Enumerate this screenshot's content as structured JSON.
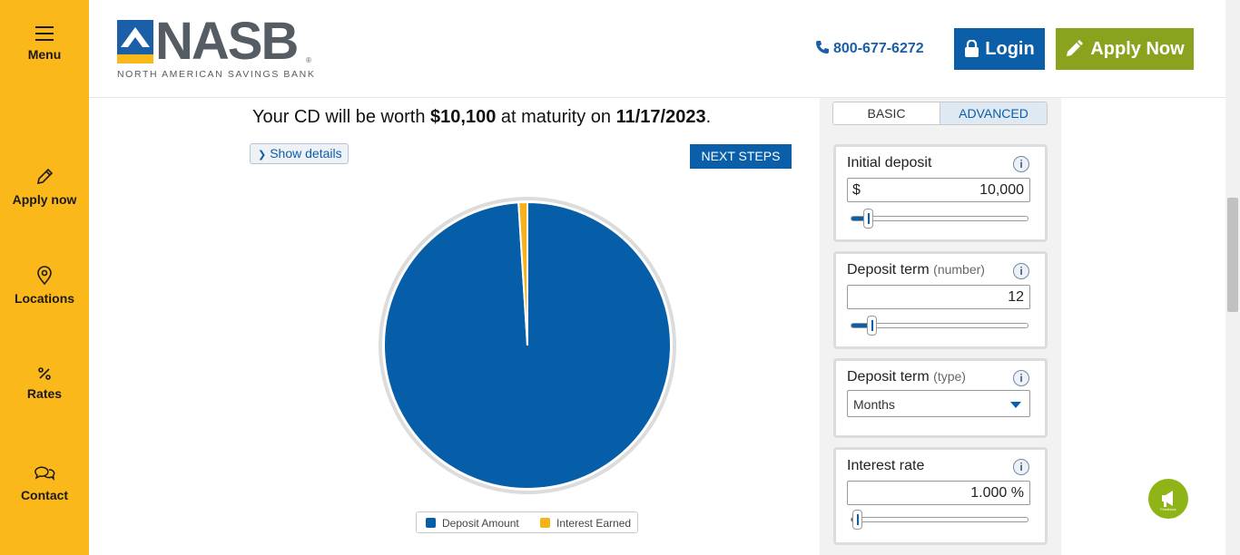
{
  "rail": {
    "menu": "Menu",
    "apply": "Apply now",
    "locations": "Locations",
    "rates": "Rates",
    "contact": "Contact"
  },
  "header": {
    "logo_word": "NASB",
    "logo_tagline": "NORTH AMERICAN SAVINGS BANK",
    "phone": "800-677-6272",
    "login": "Login",
    "apply": "Apply Now"
  },
  "summary": {
    "prefix": "Your CD will be worth ",
    "amount": "$10,100",
    "middle": " at maturity on ",
    "date": "11/17/2023",
    "suffix": "."
  },
  "actions": {
    "show_details": "Show details",
    "next_steps": "NEXT STEPS"
  },
  "chart_data": {
    "type": "pie",
    "slices": [
      {
        "label": "Deposit Amount",
        "value": 10000,
        "color": "#065da8"
      },
      {
        "label": "Interest Earned",
        "value": 100,
        "color": "#f6b21a"
      }
    ],
    "legend_position": "bottom"
  },
  "tabs": {
    "basic": "BASIC",
    "advanced": "ADVANCED",
    "active": "basic"
  },
  "inputs": {
    "initial_deposit": {
      "label": "Initial deposit",
      "prefix": "$",
      "value": "10,000",
      "slider_level": 0.08
    },
    "deposit_term_number": {
      "label": "Deposit term",
      "sub": "(number)",
      "value": "12",
      "slider_level": 0.1
    },
    "deposit_term_type": {
      "label": "Deposit term",
      "sub": "(type)",
      "value": "Months"
    },
    "interest_rate": {
      "label": "Interest rate",
      "value": "1.000 %",
      "slider_level": 0.02
    }
  },
  "feedback_label": "Feedback",
  "colors": {
    "rail": "#fbb81a",
    "brand_blue": "#0b5ea8",
    "apply_green": "#8aa31f"
  }
}
